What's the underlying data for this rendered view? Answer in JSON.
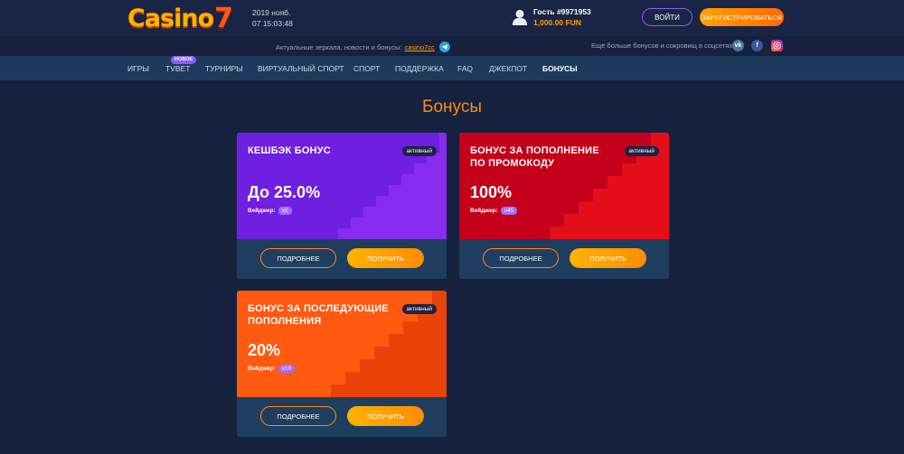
{
  "header": {
    "logo_text": "Casino",
    "logo_seven": "7",
    "date": "2019 нояб.",
    "time": "07 15:03:48",
    "user_name": "Гость #9971953",
    "user_balance": "1,000.00 FUN",
    "login_label": "ВОЙТИ",
    "register_label": "ЗАРЕГИСТРИРОВАТЬСЯ"
  },
  "subheader": {
    "mirror_text": "Актуальные зеркала, новости и бонусы:",
    "mirror_link": "casino7cc",
    "social_text": "Ещё больше бонусов и сокровищ в соцсетях:",
    "vk": "vk",
    "fb": "f"
  },
  "nav": {
    "items": [
      "ИГРЫ",
      "TVBET",
      "ТУРНИРЫ",
      "ВИРТУАЛЬНЫЙ СПОРТ",
      "СПОРТ",
      "ПОДДЕРЖКА",
      "FAQ",
      "ДЖЕКПОТ",
      "БОНУСЫ"
    ],
    "badge": "НОВОЕ",
    "active": "БОНУСЫ"
  },
  "page": {
    "title": "Бонусы"
  },
  "cards": [
    {
      "title": "КЕШБЭК БОНУС",
      "badge": "активный",
      "amount": "До 25.0%",
      "wager_label": "Вейджер:",
      "wager_value": "x1",
      "more_label": "ПОДРОБНЕЕ",
      "get_label": "ПОЛУЧИТЬ",
      "colors": [
        "#6f1fe0",
        "#9a33f0"
      ]
    },
    {
      "title": "БОНУС ЗА ПОПОЛНЕНИЕ ПО ПРОМОКОДУ",
      "badge": "активный",
      "amount": "100%",
      "wager_label": "Вейджер:",
      "wager_value": "x45",
      "more_label": "ПОДРОБНЕЕ",
      "get_label": "ПОЛУЧИТЬ",
      "colors": [
        "#c4001a",
        "#ee1a1a"
      ]
    },
    {
      "title": "БОНУС ЗА ПОСЛЕДУЮЩИЕ ПОПОЛНЕНИЯ",
      "badge": "активный",
      "amount": "20%",
      "wager_label": "Вейджер:",
      "wager_value": "x10",
      "more_label": "ПОДРОБНЕЕ",
      "get_label": "ПОЛУЧИТЬ",
      "colors": [
        "#e8430a",
        "#ff6a1a"
      ]
    }
  ]
}
